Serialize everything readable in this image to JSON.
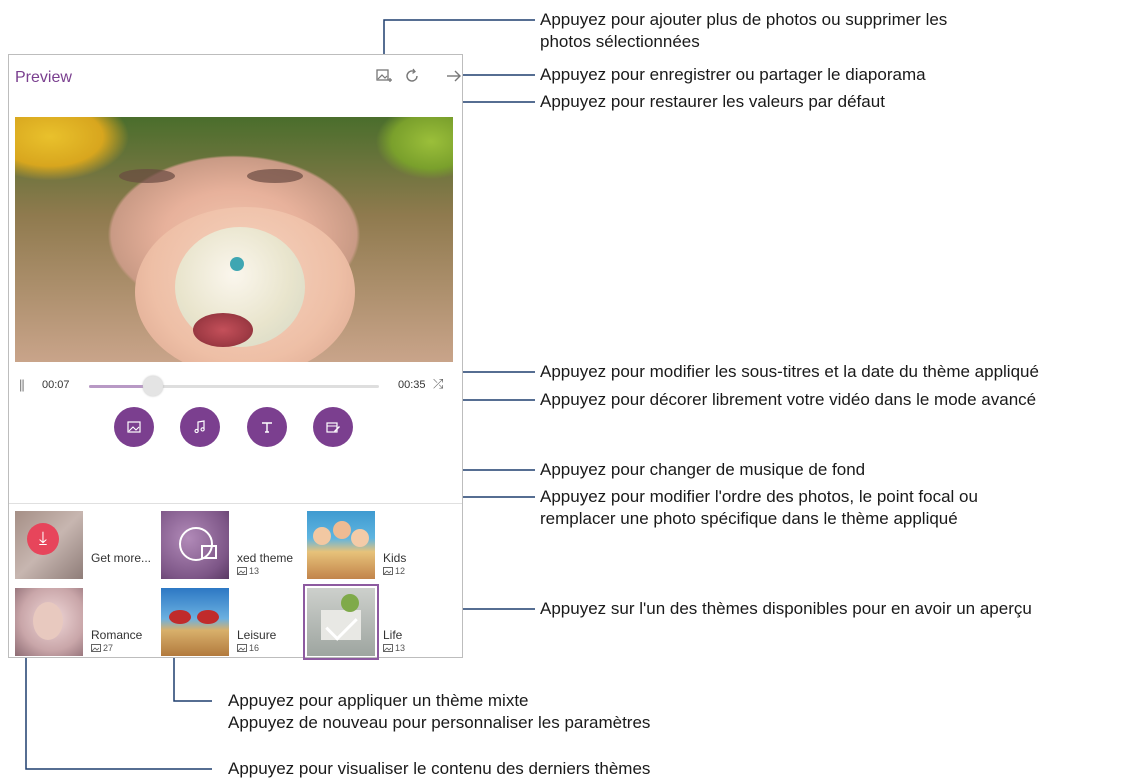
{
  "screen": {
    "title": "Preview",
    "player": {
      "pause_glyph": "||",
      "current_time": "00:07",
      "total_time": "00:35",
      "progress": 0.22,
      "shuffle_glyph": "⤮"
    },
    "themes": [
      {
        "name": "Get more...",
        "count": "",
        "thumb": "download"
      },
      {
        "name": "xed theme",
        "count": "13",
        "thumb": "reel"
      },
      {
        "name": "Kids",
        "count": "12",
        "thumb": "kids"
      },
      {
        "name": "Romance",
        "count": "27",
        "thumb": "romance"
      },
      {
        "name": "Leisure",
        "count": "16",
        "thumb": "leisure"
      },
      {
        "name": "Life",
        "count": "13",
        "thumb": "life",
        "selected": true
      }
    ],
    "accent_color": "#7b3f8f"
  },
  "annotations": {
    "add_photos_1": "Appuyez pour ajouter plus de photos ou supprimer les",
    "add_photos_2": "photos sélectionnées",
    "save_share": "Appuyez pour enregistrer ou partager le diaporama",
    "restore": "Appuyez pour restaurer les valeurs par défaut",
    "subtitles": "Appuyez pour modifier les sous-titres et la date du thème appliqué",
    "decorate": "Appuyez pour décorer librement votre vidéo dans le mode avancé",
    "music": "Appuyez pour changer de musique de fond",
    "order_1": "Appuyez pour modifier l'ordre des photos, le point focal ou",
    "order_2": "remplacer une photo spécifique dans le thème appliqué",
    "preview_theme": "Appuyez sur l'un des thèmes disponibles pour en avoir un aperçu",
    "mixed_1": "Appuyez pour appliquer un thème mixte",
    "mixed_2": "Appuyez de nouveau pour personnaliser les paramètres",
    "latest": "Appuyez pour visualiser le contenu des derniers thèmes"
  }
}
